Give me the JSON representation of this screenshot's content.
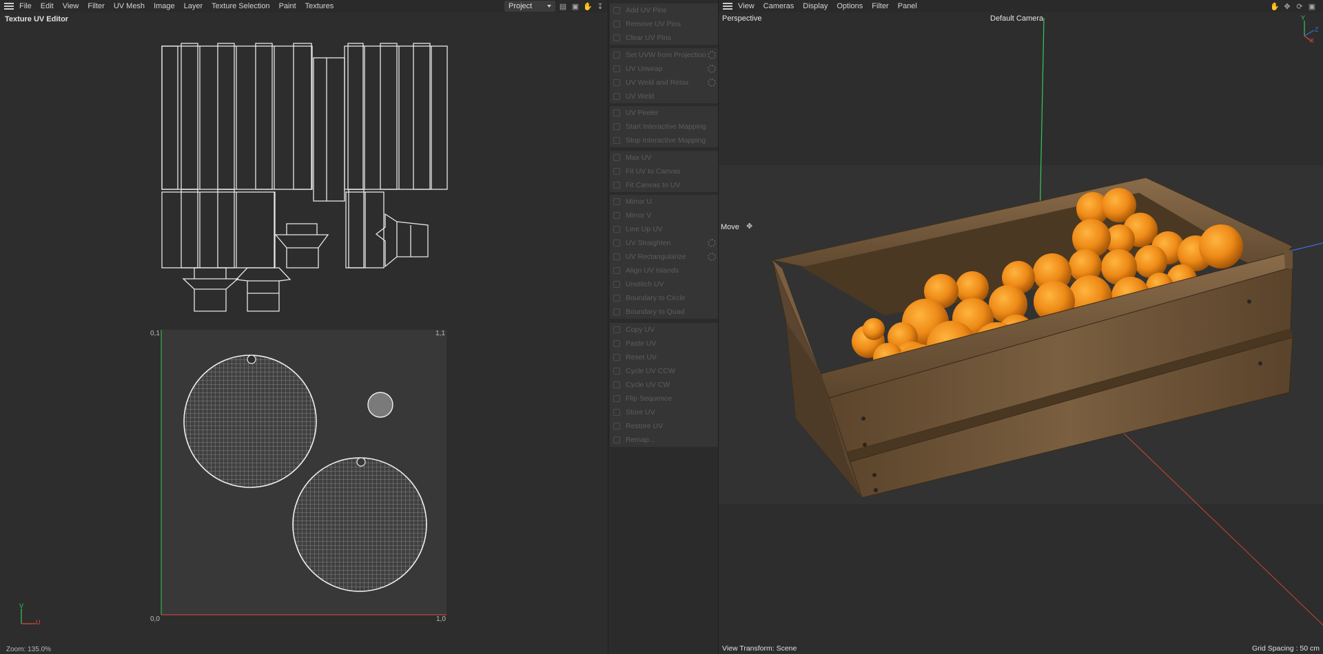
{
  "uv_editor": {
    "menu": [
      "File",
      "Edit",
      "View",
      "Filter",
      "UV Mesh",
      "Image",
      "Layer",
      "Texture Selection",
      "Paint",
      "Textures"
    ],
    "project_select": "Project",
    "panel_title": "Texture UV Editor",
    "corner_labels": {
      "top_left": "0,1",
      "top_right": "1,1",
      "bottom_left": "0,0",
      "bottom_right": "1,0"
    },
    "axis_v": "V",
    "axis_u": "U",
    "zoom": "Zoom: 135.0%"
  },
  "tools": {
    "groups": [
      [
        {
          "label": "Add UV Pins"
        },
        {
          "label": "Remove UV Pins"
        },
        {
          "label": "Clear UV Pins"
        }
      ],
      [
        {
          "label": "Set UVW from Projection",
          "gear": true
        },
        {
          "label": "UV Unwrap",
          "gear": true
        },
        {
          "label": "UV Weld and Relax",
          "gear": true
        },
        {
          "label": "UV Weld"
        }
      ],
      [
        {
          "label": "UV Peeler"
        },
        {
          "label": "Start Interactive Mapping"
        },
        {
          "label": "Stop Interactive Mapping"
        }
      ],
      [
        {
          "label": "Max UV"
        },
        {
          "label": "Fit UV to Canvas"
        },
        {
          "label": "Fit Canvas to UV"
        }
      ],
      [
        {
          "label": "Mirror U"
        },
        {
          "label": "Mirror V"
        },
        {
          "label": "Line Up UV"
        },
        {
          "label": "UV Straighten",
          "gear": true
        },
        {
          "label": "UV Rectangularize",
          "gear": true
        },
        {
          "label": "Align UV Islands"
        },
        {
          "label": "Unstitch UV"
        },
        {
          "label": "Boundary to Circle"
        },
        {
          "label": "Boundary to Quad"
        }
      ],
      [
        {
          "label": "Copy UV"
        },
        {
          "label": "Paste UV"
        },
        {
          "label": "Reset UV"
        },
        {
          "label": "Cycle UV CCW"
        },
        {
          "label": "Cycle UV CW"
        },
        {
          "label": "Flip Sequence"
        },
        {
          "label": "Store UV"
        },
        {
          "label": "Restore UV"
        },
        {
          "label": "Remap..."
        }
      ]
    ]
  },
  "viewport": {
    "menu": [
      "View",
      "Cameras",
      "Display",
      "Options",
      "Filter",
      "Panel"
    ],
    "projection": "Perspective",
    "camera": "Default Camera",
    "tool": "Move",
    "view_transform": "View Transform: Scene",
    "grid_spacing": "Grid Spacing : 50 cm",
    "gizmo": {
      "y": "Y",
      "z": "Z",
      "x": "X"
    }
  },
  "colors": {
    "background": "#2d2d2d",
    "uv_wire": "#e8e8e8",
    "axis_green": "#37c85c",
    "axis_red": "#e24a3b",
    "axis_blue": "#3a6fd8",
    "orange": "#f08a1c",
    "wood": "#6e5438"
  }
}
